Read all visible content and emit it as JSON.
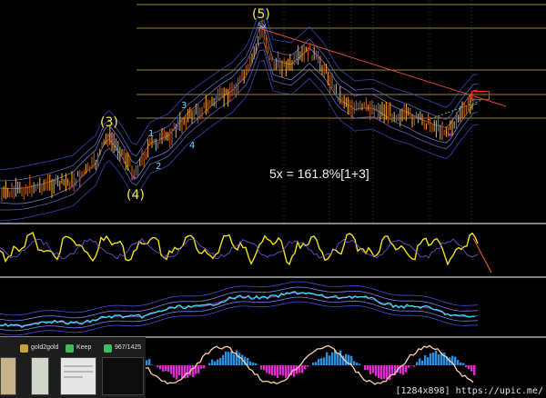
{
  "chart": {
    "wave_labels": {
      "w3": "(3)",
      "w4": "(4)",
      "w5": "(5)",
      "sub_1": "1",
      "sub_2": "2",
      "sub_3": "3",
      "sub_4": "4",
      "peak_tag": "5x"
    },
    "annotation": "5x = 161.8%[1+3]"
  },
  "taskbar": {
    "items": [
      {
        "label": "gold2gold",
        "icon": "gold-app-icon"
      },
      {
        "label": "Keep",
        "icon": "keep-icon"
      },
      {
        "label": "967/1425",
        "icon": "counter-icon"
      }
    ]
  },
  "watermark": "[1284x898] https://upic.me/",
  "colors": {
    "background": "#000000",
    "candle": "#e8a23a",
    "band_outer": "#3f4fd8",
    "band_mid": "#7a7ff0",
    "fib_line": "#d8c24a",
    "trendline": "#d84a3a",
    "oscillator": "#f2e21c",
    "cyan_line": "#3fe0ff",
    "histogram_pos": "#2b8fe0",
    "histogram_neg": "#e02bd0"
  }
}
